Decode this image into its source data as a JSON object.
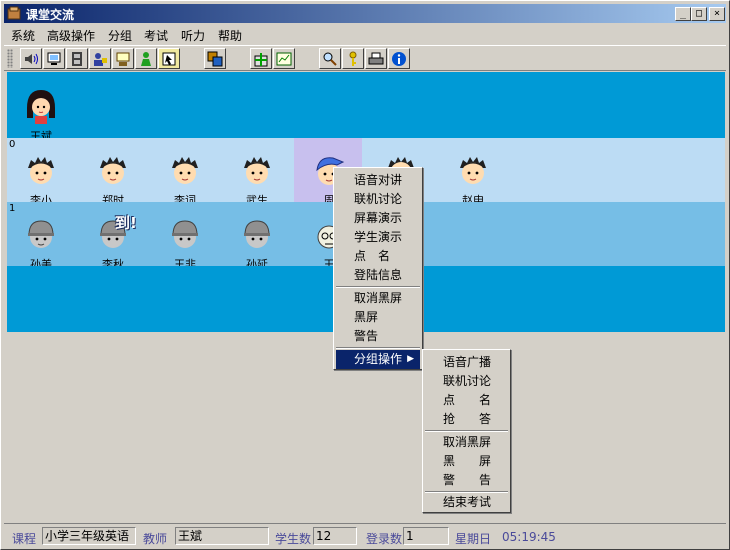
{
  "window": {
    "title": "课堂交流",
    "min": "_",
    "max": "□",
    "close": "×"
  },
  "menu": [
    "系统",
    "高级操作",
    "分组",
    "考试",
    "听力",
    "帮助"
  ],
  "toolbar": {
    "icons": [
      "speaker-icon",
      "monitor-icon",
      "film-icon",
      "student-icon",
      "projector-icon",
      "person-icon",
      "screen-select-icon",
      "copy-icon",
      "gift-icon",
      "chart-icon",
      "search-icon",
      "key-icon",
      "print-icon",
      "info-icon"
    ]
  },
  "teacher": {
    "name": "王斌"
  },
  "groups": [
    {
      "label": "0",
      "students": [
        "李小",
        "郑时",
        "李词",
        "武生",
        "周",
        "",
        "赵申"
      ]
    },
    {
      "label": "1",
      "students": [
        "孙美",
        "李秋",
        "王非",
        "孙延",
        "王"
      ]
    }
  ],
  "badge": "到!",
  "context_menu": {
    "items": [
      "语音对讲",
      "联机讨论",
      "屏幕演示",
      "学生演示",
      "点　名",
      "登陆信息",
      "取消黑屏",
      "黑屏",
      "警告",
      "分组操作"
    ]
  },
  "submenu": {
    "items": [
      "语音广播",
      "联机讨论",
      "点　　名",
      "抢　　答",
      "取消黑屏",
      "黑　　屏",
      "警　　告",
      "结束考试"
    ]
  },
  "statusbar": {
    "course_label": "课程",
    "course": "小学三年级英语",
    "teacher_label": "教师",
    "teacher": "王斌",
    "count_label": "学生数",
    "count": "12",
    "login_label": "登录数",
    "login": "1",
    "weekday": "星期日",
    "time": "05:19:45"
  }
}
